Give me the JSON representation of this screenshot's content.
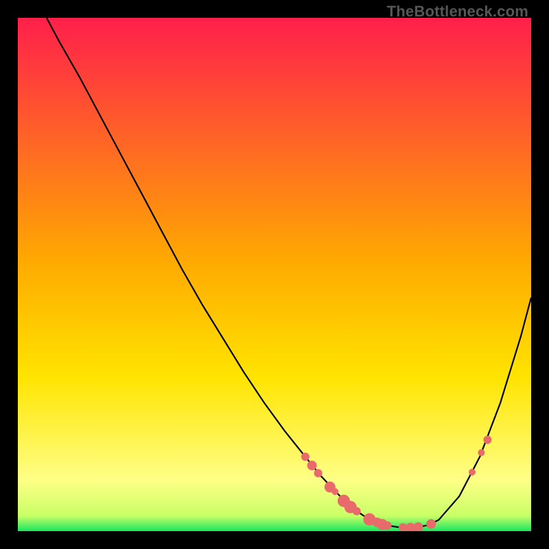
{
  "watermark": "TheBottleneck.com",
  "colors": {
    "gradient_top": "#ff1f4b",
    "gradient_mid": "#ffd400",
    "gradient_low": "#ffff7a",
    "gradient_bottom": "#18e65f",
    "curve": "#000000",
    "dot_fill": "#e86a6a",
    "dot_stroke": "#c94f4f"
  },
  "chart_data": {
    "type": "line",
    "title": "",
    "xlabel": "",
    "ylabel": "",
    "xlim": [
      0,
      100
    ],
    "ylim": [
      0,
      100
    ],
    "series": [
      {
        "name": "bottleneck-curve",
        "x": [
          5.6,
          8,
          12,
          16,
          20,
          24,
          28,
          32,
          36,
          40,
          44,
          48,
          52,
          56,
          59,
          62,
          64,
          66,
          68,
          70,
          72,
          74,
          76,
          78,
          80,
          82,
          86,
          90,
          94,
          98,
          100
        ],
        "y": [
          100,
          95.5,
          88.5,
          81,
          73.5,
          66,
          58.5,
          51,
          44,
          37.5,
          31,
          25,
          19.5,
          14.5,
          10.8,
          7.6,
          5.6,
          3.9,
          2.6,
          1.7,
          1.1,
          0.8,
          0.7,
          0.8,
          1.2,
          2.2,
          6.8,
          14.5,
          25,
          38,
          45.5
        ]
      }
    ],
    "markers": [
      {
        "x": 56.0,
        "y": 14.5,
        "r": 6
      },
      {
        "x": 57.3,
        "y": 12.8,
        "r": 7
      },
      {
        "x": 58.5,
        "y": 11.3,
        "r": 6
      },
      {
        "x": 60.8,
        "y": 8.6,
        "r": 8
      },
      {
        "x": 61.8,
        "y": 7.7,
        "r": 5
      },
      {
        "x": 63.5,
        "y": 5.9,
        "r": 9
      },
      {
        "x": 64.8,
        "y": 4.7,
        "r": 9
      },
      {
        "x": 66.0,
        "y": 3.9,
        "r": 6
      },
      {
        "x": 68.5,
        "y": 2.3,
        "r": 9
      },
      {
        "x": 70.0,
        "y": 1.7,
        "r": 7
      },
      {
        "x": 71.0,
        "y": 1.3,
        "r": 8
      },
      {
        "x": 72.0,
        "y": 1.1,
        "r": 6
      },
      {
        "x": 75.0,
        "y": 0.75,
        "r": 6
      },
      {
        "x": 76.5,
        "y": 0.7,
        "r": 7
      },
      {
        "x": 78.0,
        "y": 0.8,
        "r": 7
      },
      {
        "x": 80.5,
        "y": 1.4,
        "r": 7
      },
      {
        "x": 88.5,
        "y": 11.5,
        "r": 5
      },
      {
        "x": 90.3,
        "y": 15.3,
        "r": 5
      },
      {
        "x": 91.5,
        "y": 17.8,
        "r": 6
      }
    ]
  }
}
